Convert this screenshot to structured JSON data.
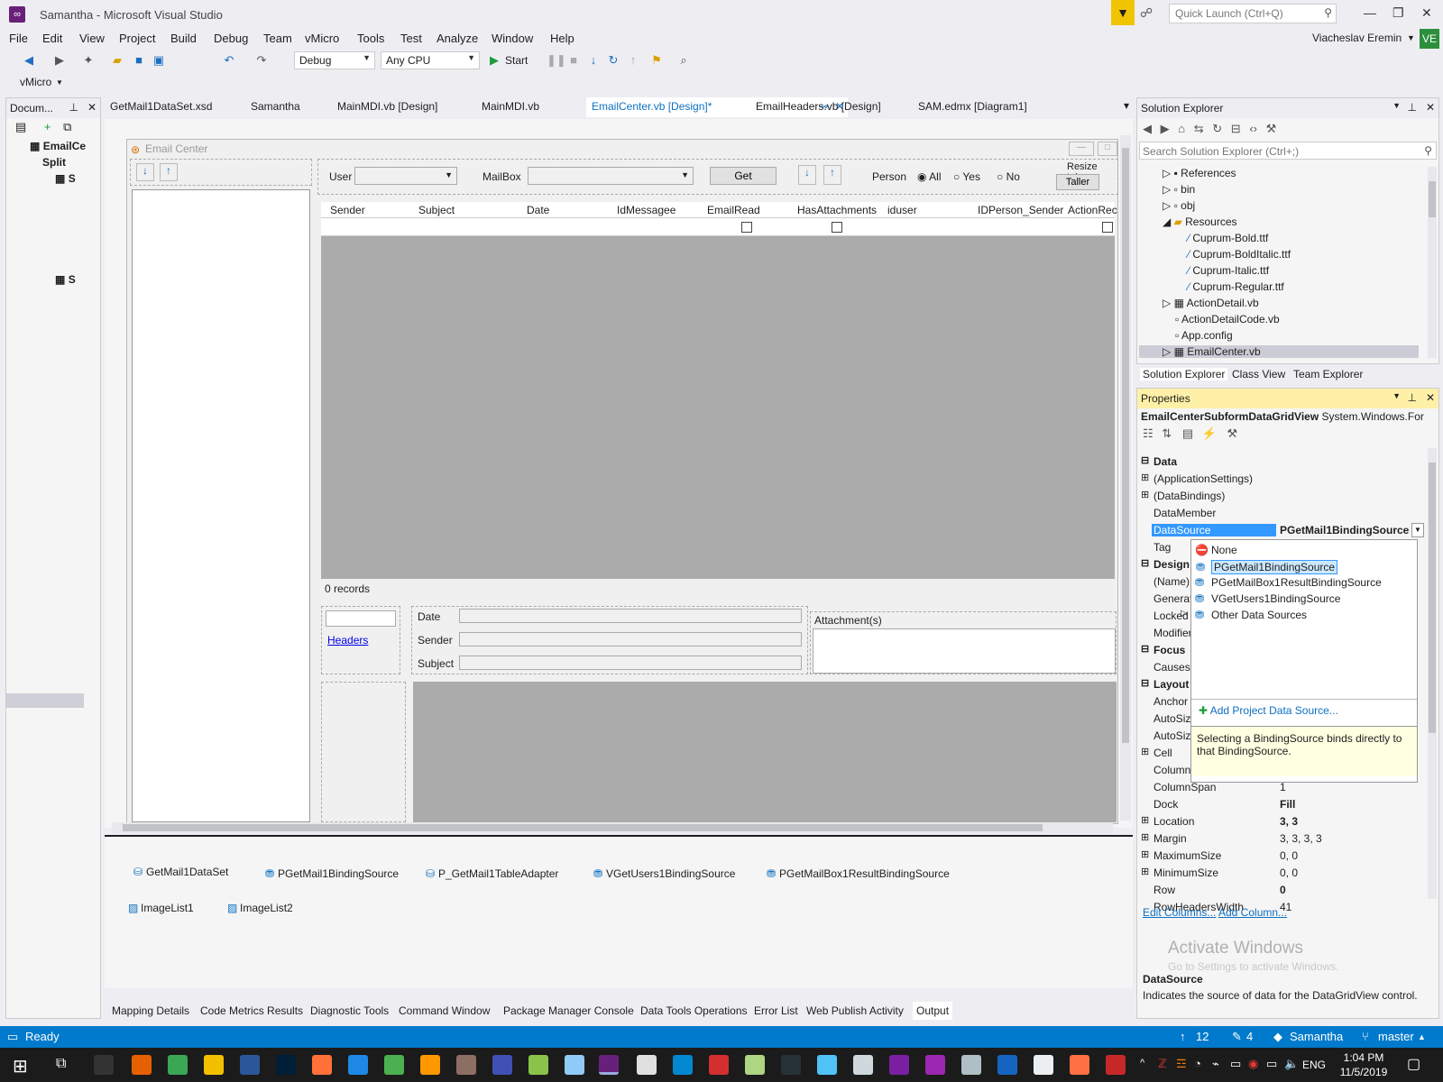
{
  "window": {
    "title": "Samantha - Microsoft Visual Studio",
    "quick_launch_placeholder": "Quick Launch (Ctrl+Q)"
  },
  "menu": [
    "File",
    "Edit",
    "View",
    "Project",
    "Build",
    "Debug",
    "Team",
    "vMicro",
    "Tools",
    "Test",
    "Analyze",
    "Window",
    "Help"
  ],
  "user": {
    "name": "Viacheslav Eremin",
    "initials": "VE"
  },
  "toolbar": {
    "config": "Debug",
    "platform": "Any CPU",
    "start": "Start",
    "vmicro": "vMicro"
  },
  "doc_panel": {
    "title": "Docum...",
    "items": [
      "EmailCe",
      "Split",
      "S",
      "S"
    ]
  },
  "doc_tabs": [
    "GetMail1DataSet.xsd",
    "Samantha",
    "MainMDI.vb [Design]",
    "MainMDI.vb",
    "EmailCenter.vb [Design]*",
    "EmailHeaders.vb [Design]",
    "SAM.edmx [Diagram1]"
  ],
  "form": {
    "caption": "Email Center",
    "user_label": "User",
    "mailbox_label": "MailBox",
    "get_button": "Get",
    "person_label": "Person",
    "radio_all": "All",
    "radio_yes": "Yes",
    "radio_no": "No",
    "resize_label": "Resize Inbo",
    "taller_button": "Taller",
    "columns": [
      "Sender",
      "Subject",
      "Date",
      "IdMessagee",
      "EmailRead",
      "HasAttachments",
      "iduser",
      "IDPerson_Sender",
      "ActionRec"
    ],
    "records": "0 records",
    "headers_link": "Headers",
    "date_label": "Date",
    "sender_label": "Sender",
    "subject_label": "Subject",
    "attachments_label": "Attachment(s)"
  },
  "tray": [
    "GetMail1DataSet",
    "PGetMail1BindingSource",
    "P_GetMail1TableAdapter",
    "VGetUsers1BindingSource",
    "PGetMailBox1ResultBindingSource",
    "ImageList1",
    "ImageList2"
  ],
  "bottom_tabs": [
    "Mapping Details",
    "Code Metrics Results",
    "Diagnostic Tools",
    "Command Window",
    "Package Manager Console",
    "Data Tools Operations",
    "Error List",
    "Web Publish Activity",
    "Output"
  ],
  "solution_explorer": {
    "title": "Solution Explorer",
    "search_placeholder": "Search Solution Explorer (Ctrl+;)",
    "items": [
      "References",
      "bin",
      "obj",
      "Resources",
      "Cuprum-Bold.ttf",
      "Cuprum-BoldItalic.ttf",
      "Cuprum-Italic.ttf",
      "Cuprum-Regular.ttf",
      "ActionDetail.vb",
      "ActionDetailCode.vb",
      "App.config",
      "EmailCenter.vb"
    ],
    "tabs": [
      "Solution Explorer",
      "Class View",
      "Team Explorer"
    ]
  },
  "properties": {
    "title": "Properties",
    "object": "EmailCenterSubformDataGridView",
    "object_type": "System.Windows.For",
    "rows": [
      {
        "name": "Data",
        "value": "",
        "cat": true
      },
      {
        "name": "(ApplicationSettings)",
        "value": ""
      },
      {
        "name": "(DataBindings)",
        "value": ""
      },
      {
        "name": "DataMember",
        "value": ""
      },
      {
        "name": "DataSource",
        "value": "PGetMail1BindingSource"
      },
      {
        "name": "Tag",
        "value": ""
      },
      {
        "name": "Design",
        "value": "",
        "cat": true
      },
      {
        "name": "(Name)",
        "value": ""
      },
      {
        "name": "Generate",
        "value": ""
      },
      {
        "name": "Locked",
        "value": ""
      },
      {
        "name": "Modifier",
        "value": ""
      },
      {
        "name": "Focus",
        "value": "",
        "cat": true
      },
      {
        "name": "CausesV",
        "value": ""
      },
      {
        "name": "Layout",
        "value": "",
        "cat": true
      },
      {
        "name": "Anchor",
        "value": ""
      },
      {
        "name": "AutoSize",
        "value": ""
      },
      {
        "name": "AutoSize",
        "value": ""
      },
      {
        "name": "Cell",
        "value": ""
      },
      {
        "name": "Column",
        "value": ""
      },
      {
        "name": "ColumnSpan",
        "value": "1"
      },
      {
        "name": "Dock",
        "value": "Fill"
      },
      {
        "name": "Location",
        "value": "3, 3"
      },
      {
        "name": "Margin",
        "value": "3, 3, 3, 3"
      },
      {
        "name": "MaximumSize",
        "value": "0, 0"
      },
      {
        "name": "MinimumSize",
        "value": "0, 0"
      },
      {
        "name": "Row",
        "value": "0"
      },
      {
        "name": "RowHeadersWidth",
        "value": "41"
      }
    ],
    "links": [
      "Edit Columns...",
      "Add Column..."
    ],
    "desc_title": "DataSource",
    "desc_text": "Indicates the source of data for the DataGridView control.",
    "watermark": "Activate Windows",
    "watermark_sub": "Go to Settings to activate Windows."
  },
  "dropdown": {
    "options": [
      "None",
      "PGetMail1BindingSource",
      "PGetMailBox1ResultBindingSource",
      "VGetUsers1BindingSource",
      "Other Data Sources"
    ],
    "add_link": "Add Project Data Source...",
    "tip": "Selecting a BindingSource binds directly to that BindingSource."
  },
  "status": {
    "text": "Ready",
    "up": "12",
    "edits": "4",
    "project": "Samantha",
    "branch": "master"
  },
  "clock": {
    "time": "1:04 PM",
    "date": "11/5/2019",
    "lang": "ENG"
  }
}
